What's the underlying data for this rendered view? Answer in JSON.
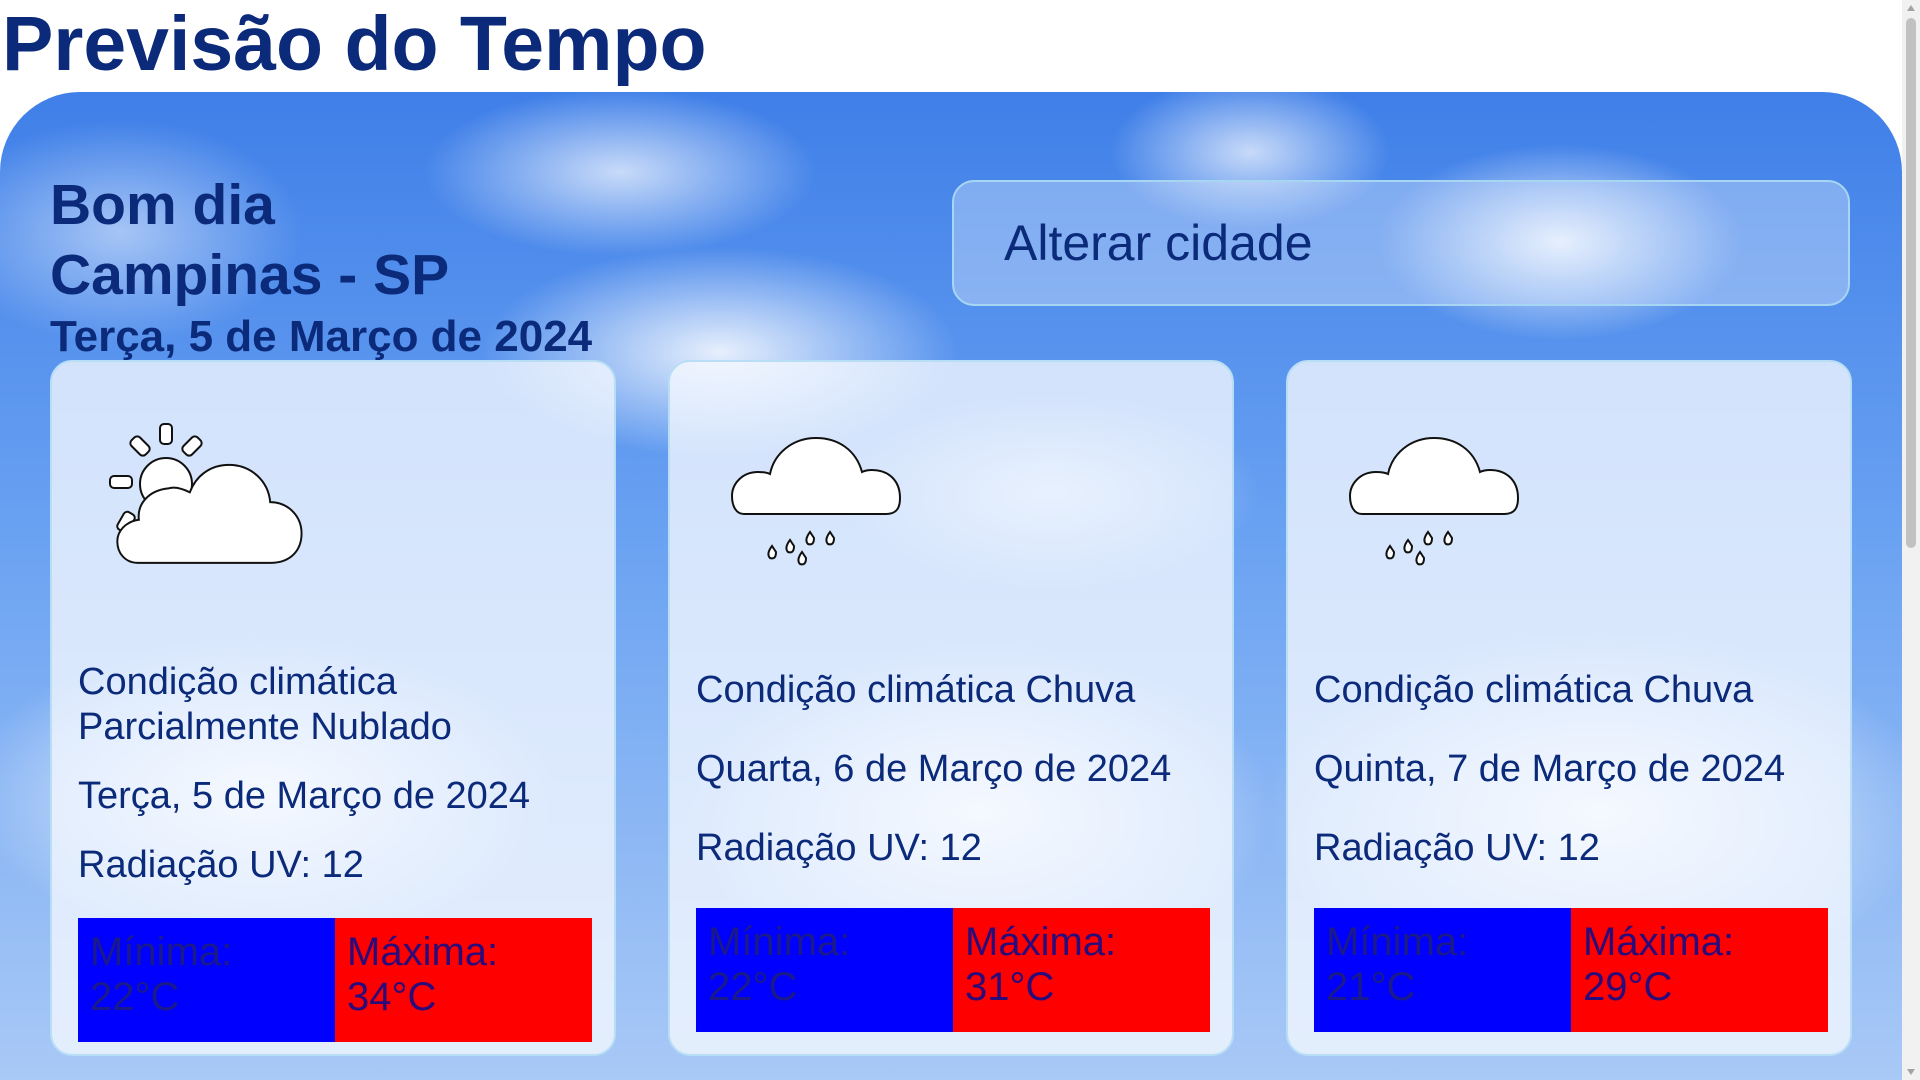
{
  "page": {
    "title": "Previsão do Tempo"
  },
  "greeting": {
    "hello": "Bom dia",
    "city": "Campinas - SP",
    "date": "Terça, 5 de Março de 2024"
  },
  "search": {
    "change_city_label": "Alterar cidade"
  },
  "colors": {
    "text": "#0b2a7a",
    "min_bg": "#0000fe",
    "max_bg": "#fe0000",
    "card_border": "#b7def5"
  },
  "forecast": [
    {
      "icon": "partly-cloudy-icon",
      "condition": "Condição climática Parcialmente Nublado",
      "date": "Terça, 5 de Março de 2024",
      "uv": "Radiação UV: 12",
      "min_label": "Mínima:",
      "min_value": "22°C",
      "max_label": "Máxima:",
      "max_value": "34°C"
    },
    {
      "icon": "rain-cloud-icon",
      "condition": "Condição climática Chuva",
      "date": "Quarta, 6 de Março de 2024",
      "uv": "Radiação UV: 12",
      "min_label": "Mínima:",
      "min_value": "22°C",
      "max_label": "Máxima:",
      "max_value": "31°C"
    },
    {
      "icon": "rain-cloud-icon",
      "condition": "Condição climática Chuva",
      "date": "Quinta, 7 de Março de 2024",
      "uv": "Radiação UV: 12",
      "min_label": "Mínima:",
      "min_value": "21°C",
      "max_label": "Máxima:",
      "max_value": "29°C"
    }
  ]
}
